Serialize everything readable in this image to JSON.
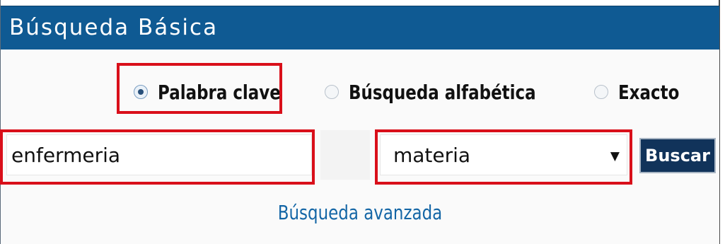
{
  "header": {
    "title": "Búsqueda Básica"
  },
  "search_mode": {
    "options": [
      {
        "label": "Palabra clave",
        "checked": true
      },
      {
        "label": "Búsqueda alfabética",
        "checked": false
      },
      {
        "label": "Exacto",
        "checked": false
      }
    ]
  },
  "search": {
    "value": "enfermeria"
  },
  "field_select": {
    "selected": "materia"
  },
  "buttons": {
    "search_label": "Buscar"
  },
  "links": {
    "advanced_search": "Búsqueda avanzada"
  },
  "colors": {
    "header": "#0f5a93",
    "highlight": "#d90f1a",
    "button": "#11335a",
    "link": "#1466a6"
  }
}
